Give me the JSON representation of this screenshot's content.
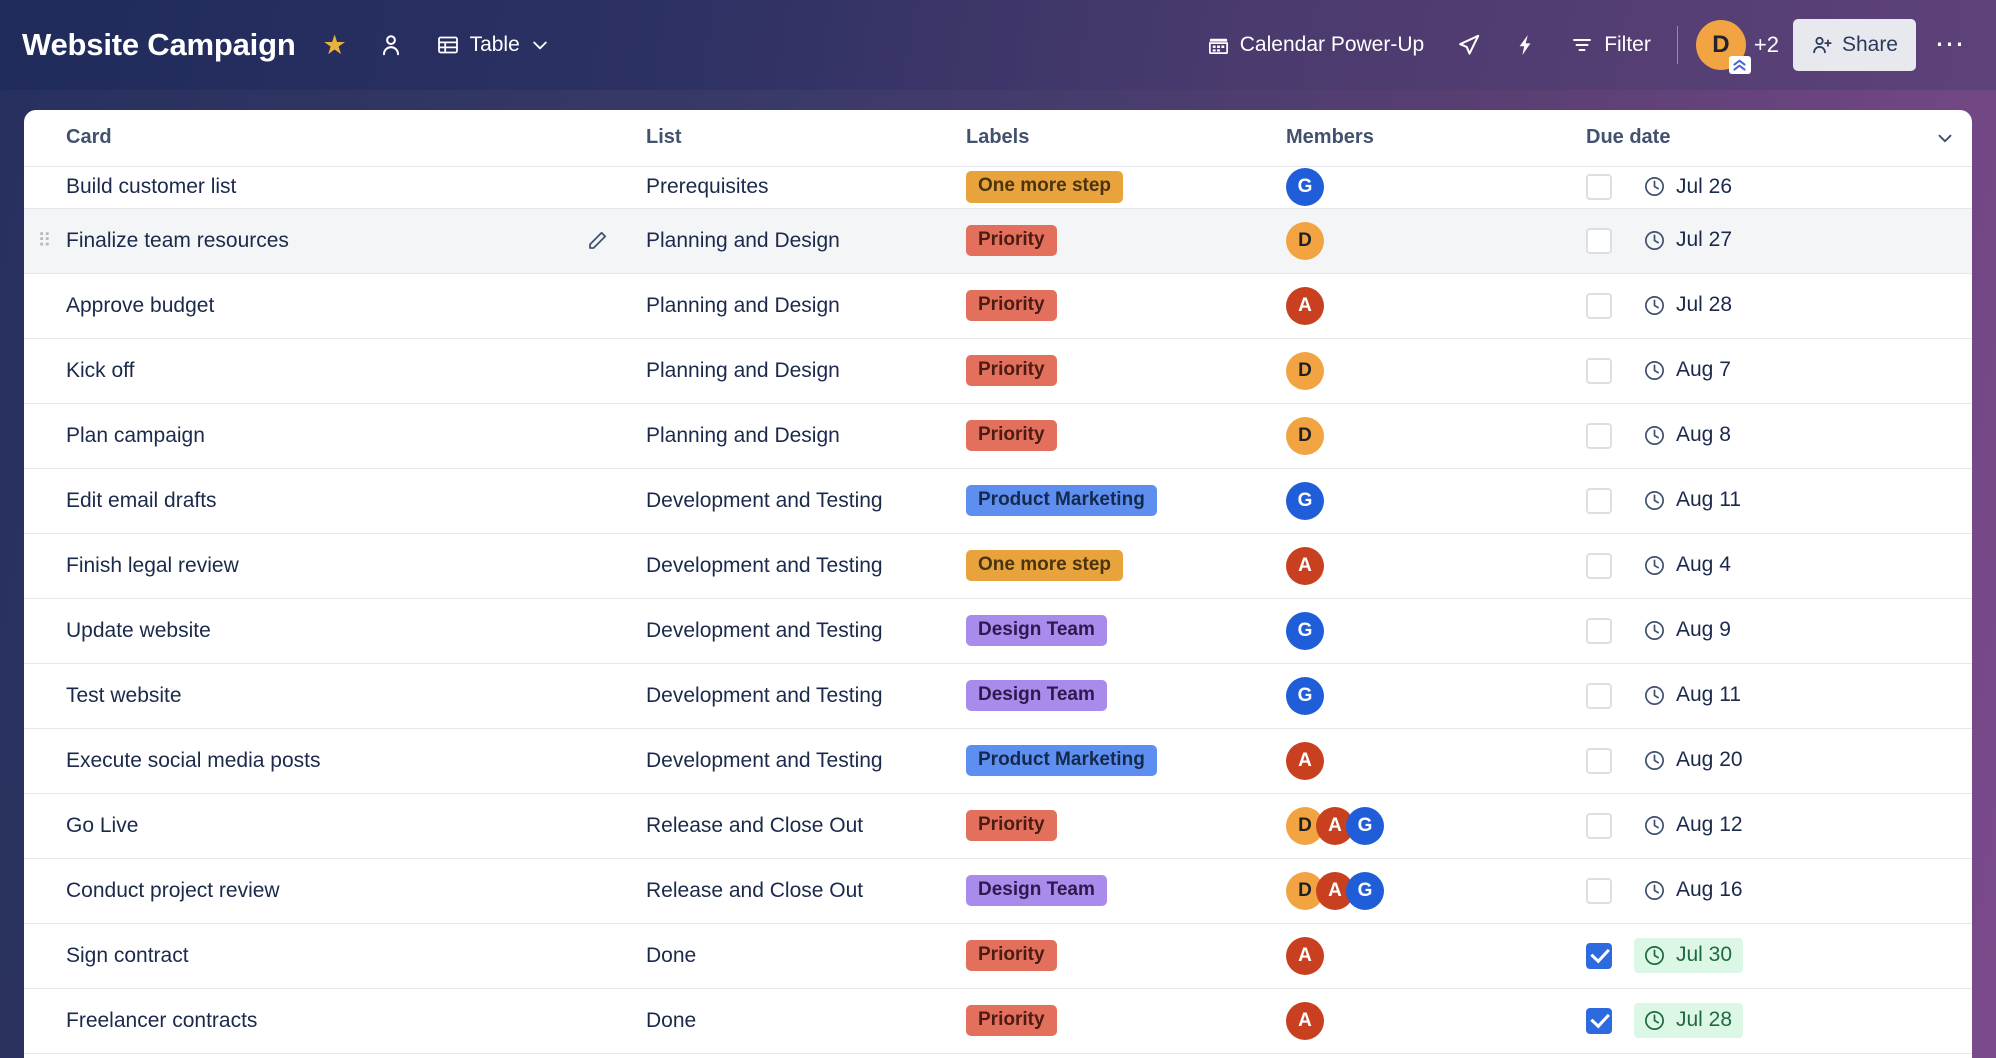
{
  "board": {
    "title": "Website Campaign",
    "star_icon": "star-icon",
    "members_icon": "board-members-icon",
    "view_label": "Table",
    "view_icon": "table-view-icon",
    "view_chevron": "chevron-down-icon",
    "powerup_label": "Calendar Power-Up",
    "powerup_icon": "calendar-icon",
    "rocket_icon": "automation-rocket-icon",
    "bolt_icon": "butler-bolt-icon",
    "filter_label": "Filter",
    "filter_icon": "filter-icon",
    "avatar_initial": "D",
    "avatar_color": "#f2a442",
    "premium_badge_icon": "premium-chevrons-icon",
    "extra_members": "+2",
    "share_label": "Share",
    "share_icon": "person-add-icon",
    "more_icon": "more-horizontal-icon"
  },
  "table": {
    "headers": {
      "card": "Card",
      "list": "List",
      "labels": "Labels",
      "members": "Members",
      "due_date": "Due date",
      "collapse_icon": "chevron-down-icon"
    },
    "rows": [
      {
        "card": "Build customer list",
        "list": "Prerequisites",
        "labels": [
          {
            "text": "One more step",
            "tone": "orange"
          }
        ],
        "members": [
          {
            "initial": "G",
            "color": "blue"
          }
        ],
        "due": "Jul 26",
        "complete": false,
        "clipped": true,
        "hovered": false
      },
      {
        "card": "Finalize team resources",
        "list": "Planning and Design",
        "labels": [
          {
            "text": "Priority",
            "tone": "red"
          }
        ],
        "members": [
          {
            "initial": "D",
            "color": "orange"
          }
        ],
        "due": "Jul 27",
        "complete": false,
        "clipped": false,
        "hovered": true
      },
      {
        "card": "Approve budget",
        "list": "Planning and Design",
        "labels": [
          {
            "text": "Priority",
            "tone": "red"
          }
        ],
        "members": [
          {
            "initial": "A",
            "color": "red"
          }
        ],
        "due": "Jul 28",
        "complete": false,
        "clipped": false,
        "hovered": false
      },
      {
        "card": "Kick off",
        "list": "Planning and Design",
        "labels": [
          {
            "text": "Priority",
            "tone": "red"
          }
        ],
        "members": [
          {
            "initial": "D",
            "color": "orange"
          }
        ],
        "due": "Aug 7",
        "complete": false,
        "clipped": false,
        "hovered": false
      },
      {
        "card": "Plan campaign",
        "list": "Planning and Design",
        "labels": [
          {
            "text": "Priority",
            "tone": "red"
          }
        ],
        "members": [
          {
            "initial": "D",
            "color": "orange"
          }
        ],
        "due": "Aug 8",
        "complete": false,
        "clipped": false,
        "hovered": false
      },
      {
        "card": "Edit email drafts",
        "list": "Development and Testing",
        "labels": [
          {
            "text": "Product Marketing",
            "tone": "blue"
          }
        ],
        "members": [
          {
            "initial": "G",
            "color": "blue"
          }
        ],
        "due": "Aug 11",
        "complete": false,
        "clipped": false,
        "hovered": false
      },
      {
        "card": "Finish legal review",
        "list": "Development and Testing",
        "labels": [
          {
            "text": "One more step",
            "tone": "orange"
          }
        ],
        "members": [
          {
            "initial": "A",
            "color": "red"
          }
        ],
        "due": "Aug 4",
        "complete": false,
        "clipped": false,
        "hovered": false
      },
      {
        "card": "Update website",
        "list": "Development and Testing",
        "labels": [
          {
            "text": "Design Team",
            "tone": "purple"
          }
        ],
        "members": [
          {
            "initial": "G",
            "color": "blue"
          }
        ],
        "due": "Aug 9",
        "complete": false,
        "clipped": false,
        "hovered": false
      },
      {
        "card": "Test website",
        "list": "Development and Testing",
        "labels": [
          {
            "text": "Design Team",
            "tone": "purple"
          }
        ],
        "members": [
          {
            "initial": "G",
            "color": "blue"
          }
        ],
        "due": "Aug 11",
        "complete": false,
        "clipped": false,
        "hovered": false
      },
      {
        "card": "Execute social media posts",
        "list": "Development and Testing",
        "labels": [
          {
            "text": "Product Marketing",
            "tone": "blue"
          }
        ],
        "members": [
          {
            "initial": "A",
            "color": "red"
          }
        ],
        "due": "Aug 20",
        "complete": false,
        "clipped": false,
        "hovered": false
      },
      {
        "card": "Go Live",
        "list": "Release and Close Out",
        "labels": [
          {
            "text": "Priority",
            "tone": "red"
          }
        ],
        "members": [
          {
            "initial": "D",
            "color": "orange"
          },
          {
            "initial": "A",
            "color": "red"
          },
          {
            "initial": "G",
            "color": "blue"
          }
        ],
        "due": "Aug 12",
        "complete": false,
        "clipped": false,
        "hovered": false
      },
      {
        "card": "Conduct project review",
        "list": "Release and Close Out",
        "labels": [
          {
            "text": "Design Team",
            "tone": "purple"
          }
        ],
        "members": [
          {
            "initial": "D",
            "color": "orange"
          },
          {
            "initial": "A",
            "color": "red"
          },
          {
            "initial": "G",
            "color": "blue"
          }
        ],
        "due": "Aug 16",
        "complete": false,
        "clipped": false,
        "hovered": false
      },
      {
        "card": "Sign contract",
        "list": "Done",
        "labels": [
          {
            "text": "Priority",
            "tone": "red"
          }
        ],
        "members": [
          {
            "initial": "A",
            "color": "red"
          }
        ],
        "due": "Jul 30",
        "complete": true,
        "clipped": false,
        "hovered": false
      },
      {
        "card": "Freelancer contracts",
        "list": "Done",
        "labels": [
          {
            "text": "Priority",
            "tone": "red"
          }
        ],
        "members": [
          {
            "initial": "A",
            "color": "red"
          }
        ],
        "due": "Jul 28",
        "complete": true,
        "clipped": false,
        "hovered": false
      }
    ]
  },
  "colors": {
    "label_orange": "#e8a33d",
    "label_red": "#e2705c",
    "label_blue": "#5e8ff0",
    "label_purple": "#a98bec",
    "avatar_orange": "#f2a442",
    "avatar_red": "#c8401f",
    "avatar_blue": "#1f5ed8",
    "checkbox_checked": "#2d6ae0",
    "due_complete_bg": "#dcf7e6",
    "due_complete_text": "#1f6b3f",
    "header_text": "#42526e",
    "row_text": "#1b2a4b"
  }
}
